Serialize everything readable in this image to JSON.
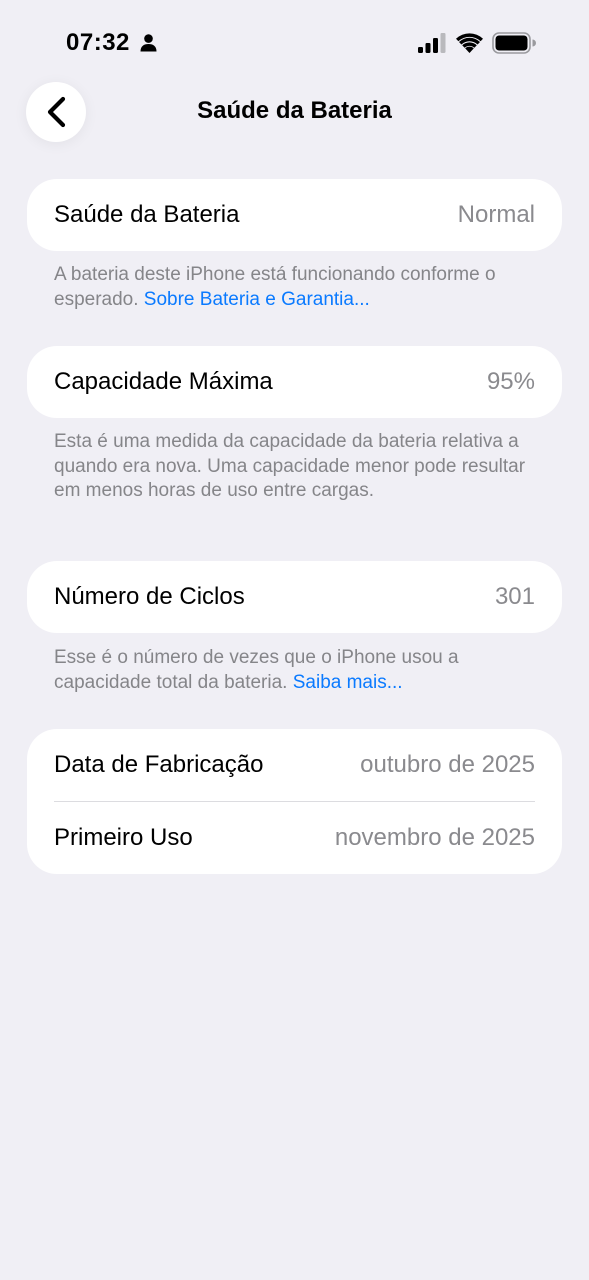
{
  "status_bar": {
    "time": "07:32",
    "icons": [
      "person-icon",
      "signal-icon",
      "wifi-icon",
      "battery-icon"
    ]
  },
  "nav": {
    "title": "Saúde da Bateria",
    "back_icon": "chevron-left-icon"
  },
  "battery_health": {
    "label": "Saúde da Bateria",
    "value": "Normal",
    "footnote": "A bateria deste iPhone está funcionando conforme o esperado. ",
    "link": "Sobre Bateria e Garantia..."
  },
  "max_capacity": {
    "label": "Capacidade Máxima",
    "value": "95%",
    "footnote": "Esta é uma medida da capacidade da bateria relativa a quando era nova. Uma capacidade menor pode resultar em menos horas de uso entre cargas."
  },
  "cycle_count": {
    "label": "Número de Ciclos",
    "value": "301",
    "footnote": "Esse é o número de vezes que o iPhone usou a capacidade total da bateria. ",
    "link": "Saiba mais..."
  },
  "dates": {
    "manufacture_label": "Data de Fabricação",
    "manufacture_value": "outubro de 2025",
    "first_use_label": "Primeiro Uso",
    "first_use_value": "novembro de 2025"
  },
  "colors": {
    "background": "#f0eff5",
    "card": "#ffffff",
    "link": "#0a7aff",
    "secondary_text": "#8a8a8e"
  }
}
